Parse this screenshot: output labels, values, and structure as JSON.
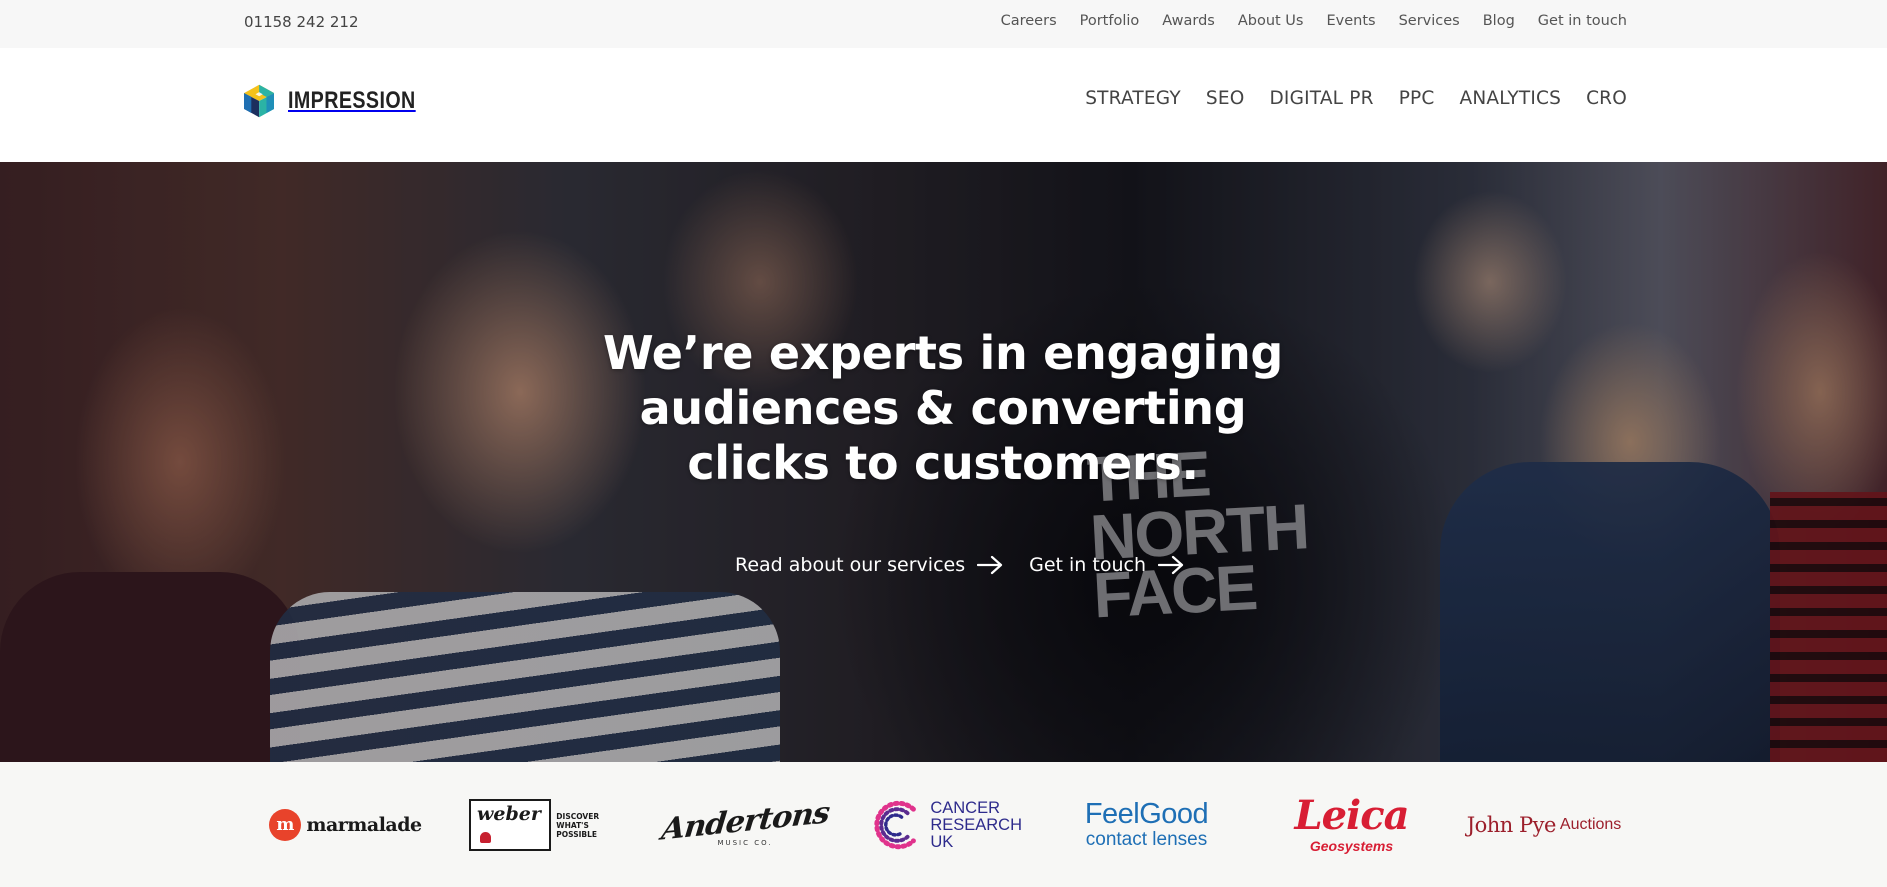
{
  "topbar": {
    "phone": "01158 242 212",
    "links": [
      "Careers",
      "Portfolio",
      "Awards",
      "About Us",
      "Events",
      "Services",
      "Blog",
      "Get in touch"
    ]
  },
  "header": {
    "logo_text": "IMPRESSION",
    "nav": [
      "STRATEGY",
      "SEO",
      "DIGITAL PR",
      "PPC",
      "ANALYTICS",
      "CRO"
    ]
  },
  "hero": {
    "headline_lines": [
      "We’re experts in engaging",
      "audiences & converting",
      "clicks to customers."
    ],
    "tee_print": [
      "THE",
      "NORTH",
      "FACE"
    ],
    "cta_services": "Read about our services",
    "cta_contact": "Get in touch",
    "arrow_icon": "arrow-right-icon"
  },
  "clients": {
    "marmalade": {
      "mark": "m",
      "name": "marmalade"
    },
    "weber": {
      "name": "weber",
      "tagline_1": "DISCOVER",
      "tagline_2": "WHAT'S POSSIBLE"
    },
    "andertons": {
      "name": "Andertons",
      "sub": "MUSIC CO."
    },
    "cruk": {
      "line1": "CANCER",
      "line2": "RESEARCH",
      "line3": "UK"
    },
    "feelgood": {
      "line1": "FeelGood",
      "line2": "contact lenses"
    },
    "leica": {
      "line1": "Leica",
      "line2": "Geosystems"
    },
    "johnpye": {
      "name": "John Pye",
      "suffix": "Auctions"
    }
  },
  "colors": {
    "topbar_bg": "#f7f7f7",
    "clients_bg": "#f7f7f5",
    "logo_blue": "#1f6fb2",
    "logo_teal": "#2bb3a5",
    "logo_yellow": "#f4c21b",
    "logo_navy": "#1c2f5e"
  }
}
